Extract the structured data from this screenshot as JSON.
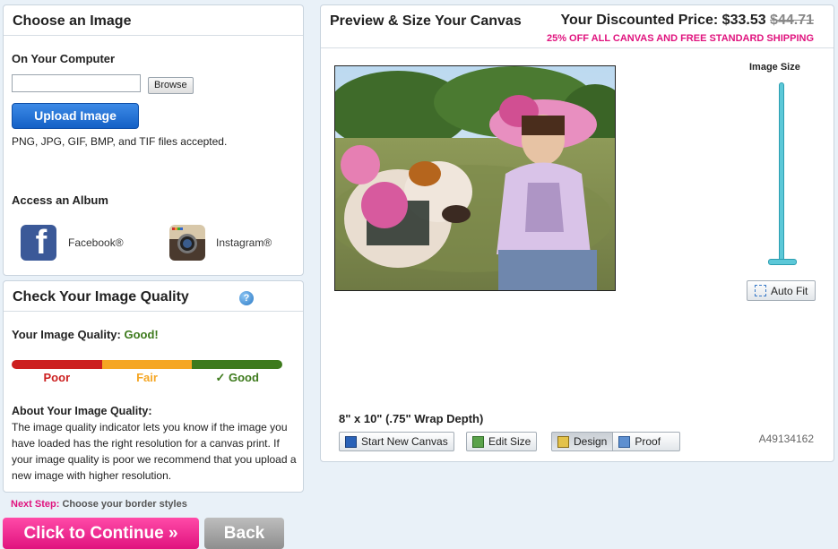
{
  "choose": {
    "title": "Choose an Image",
    "computer_label": "On Your Computer",
    "file_value": "",
    "browse_label": "Browse",
    "upload_label": "Upload Image",
    "formats_text": "PNG, JPG, GIF, BMP, and TIF files accepted.",
    "album_label": "Access an Album",
    "albums": [
      {
        "label": "Facebook®",
        "icon": "facebook-icon"
      },
      {
        "label": "Instagram®",
        "icon": "instagram-icon"
      }
    ]
  },
  "quality": {
    "title": "Check Your Image Quality",
    "help_glyph": "?",
    "status_label": "Your Image Quality:",
    "status_value": "Good!",
    "levels": [
      {
        "label": "Poor",
        "color": "#cc1f1f"
      },
      {
        "label": "Fair",
        "color": "#f5a623"
      },
      {
        "label": "✓ Good",
        "color": "#3d7a1c"
      }
    ],
    "about_title": "About Your Image Quality:",
    "about_text": "The image quality indicator lets you know if the image you have loaded has the right resolution for a canvas print. If your image quality is poor we recommend that you upload a new image with higher resolution."
  },
  "preview": {
    "title": "Preview & Size Your Canvas",
    "price_label": "Your Discounted Price:",
    "price": "$33.53",
    "original_price": "$44.71",
    "promo": "25% OFF ALL CANVAS AND FREE STANDARD SHIPPING",
    "image_size_label": "Image Size",
    "image_size_level": 1.0,
    "auto_fit_label": "Auto Fit",
    "size_text": "8\" x 10\" (.75\" Wrap Depth)",
    "start_new_label": "Start New Canvas",
    "edit_size_label": "Edit Size",
    "design_label": "Design",
    "proof_label": "Proof",
    "item_code": "A49134162"
  },
  "footer": {
    "next_step_label": "Next Step:",
    "next_step_text": "Choose your border styles",
    "continue_label": "Click to Continue »",
    "back_label": "Back"
  },
  "colors": {
    "accent_pink": "#e0137e",
    "upload_blue": "#1460c6",
    "slider_cyan": "#5cc8d8"
  }
}
